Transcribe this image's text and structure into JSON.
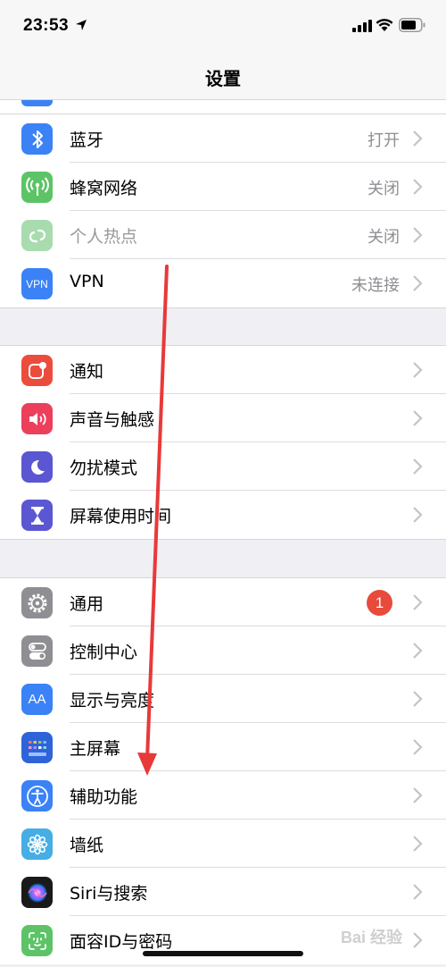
{
  "status_bar": {
    "time": "23:53"
  },
  "nav": {
    "title": "设置"
  },
  "sections": [
    {
      "rows": [
        {
          "label": "蓝牙",
          "value": "打开",
          "icon": "bluetooth-icon",
          "color": "#3a82f6"
        },
        {
          "label": "蜂窝网络",
          "value": "关闭",
          "icon": "antenna-icon",
          "color": "#5cc466"
        },
        {
          "label": "个人热点",
          "value": "关闭",
          "icon": "hotspot-icon",
          "color": "#a8dcaf",
          "dim": true
        },
        {
          "label": "VPN",
          "value": "未连接",
          "icon": "vpn-icon",
          "icon_text": "VPN",
          "color": "#3a82f6"
        }
      ]
    },
    {
      "rows": [
        {
          "label": "通知",
          "icon": "notification-icon",
          "color": "#ec4c3c"
        },
        {
          "label": "声音与触感",
          "icon": "speaker-icon",
          "color": "#ec3f5c"
        },
        {
          "label": "勿扰模式",
          "icon": "moon-icon",
          "color": "#5b56d2"
        },
        {
          "label": "屏幕使用时间",
          "icon": "hourglass-icon",
          "color": "#5b56d2"
        }
      ]
    },
    {
      "rows": [
        {
          "label": "通用",
          "icon": "gear-icon",
          "color": "#8e8e93",
          "badge": "1"
        },
        {
          "label": "控制中心",
          "icon": "toggles-icon",
          "color": "#8e8e93"
        },
        {
          "label": "显示与亮度",
          "icon": "text-size-icon",
          "icon_text": "AA",
          "color": "#3a82f6"
        },
        {
          "label": "主屏幕",
          "icon": "home-screen-icon",
          "color": "#2f63d9"
        },
        {
          "label": "辅助功能",
          "icon": "accessibility-icon",
          "color": "#3a82f6"
        },
        {
          "label": "墙纸",
          "icon": "flower-icon",
          "color": "#46aee4"
        },
        {
          "label": "Siri与搜索",
          "icon": "siri-icon",
          "color": "#222"
        },
        {
          "label": "面容ID与密码",
          "icon": "face-id-icon",
          "color": "#5cc466"
        }
      ]
    }
  ],
  "watermark": "Bai 经验"
}
